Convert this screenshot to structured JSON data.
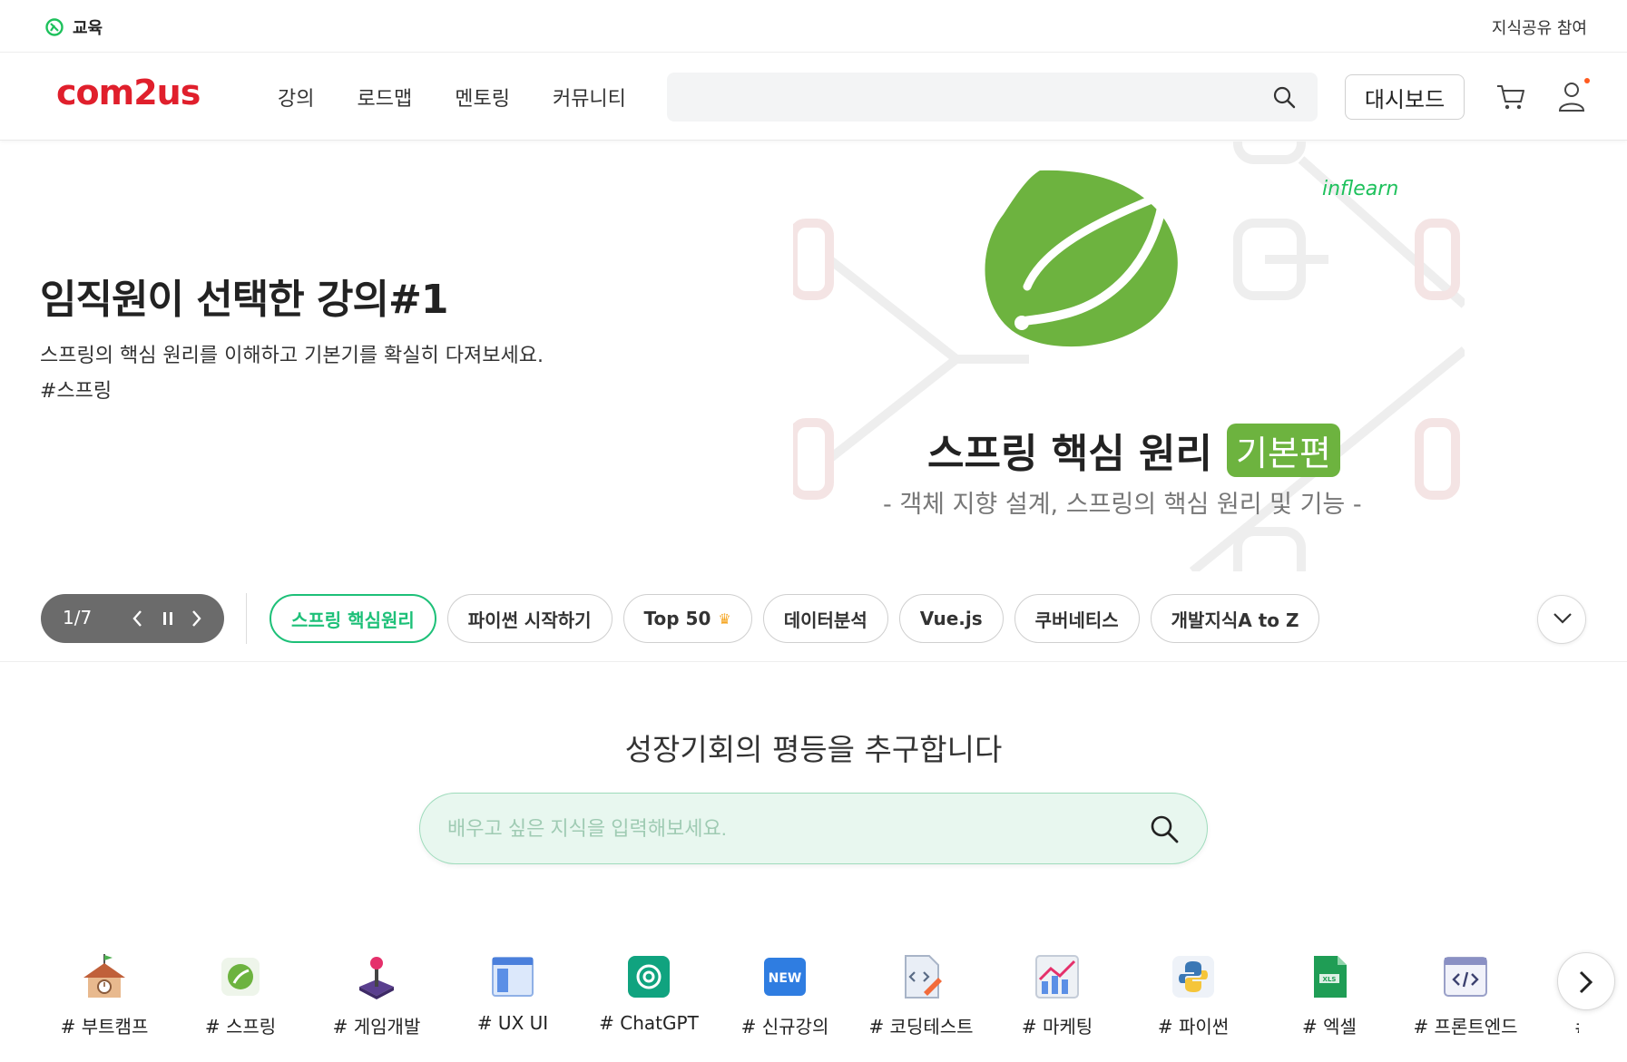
{
  "topbar": {
    "edu_label": "교육",
    "share_label": "지식공유 참여"
  },
  "header": {
    "logo": "com2us",
    "nav": [
      "강의",
      "로드맵",
      "멘토링",
      "커뮤니티"
    ],
    "search_placeholder": "",
    "dashboard_label": "대시보드"
  },
  "hero": {
    "title": "임직원이 선택한 강의#1",
    "subtitle": "스프링의 핵심 원리를 이해하고 기본기를 확실히 다져보세요.",
    "tag": "#스프링",
    "art": {
      "brand": "inflearn",
      "title": "스프링 핵심 원리",
      "badge": "기본편",
      "subtitle": "- 객체 지향 설계, 스프링의 핵심 원리 및 기능 -"
    }
  },
  "carousel": {
    "count": "1/7",
    "chips": [
      {
        "label": "스프링 핵심원리",
        "active": true
      },
      {
        "label": "파이썬 시작하기",
        "active": false
      },
      {
        "label": "Top 50",
        "active": false,
        "icon": "crown-icon"
      },
      {
        "label": "데이터분석",
        "active": false
      },
      {
        "label": "Vue.js",
        "active": false
      },
      {
        "label": "쿠버네티스",
        "active": false
      },
      {
        "label": "개발지식A to Z",
        "active": false
      }
    ]
  },
  "mission": "성장기회의 평등을 추구합니다",
  "main_search": {
    "placeholder": "배우고 싶은 지식을 입력해보세요."
  },
  "categories": [
    {
      "label": "# 부트캠프",
      "icon": "school-house-icon"
    },
    {
      "label": "# 스프링",
      "icon": "spring-leaf-icon"
    },
    {
      "label": "# 게임개발",
      "icon": "joystick-icon"
    },
    {
      "label": "# UX UI",
      "icon": "window-layout-icon"
    },
    {
      "label": "# ChatGPT",
      "icon": "chatgpt-icon"
    },
    {
      "label": "# 신규강의",
      "icon": "new-badge-icon"
    },
    {
      "label": "# 코딩테스트",
      "icon": "code-document-icon"
    },
    {
      "label": "# 마케팅",
      "icon": "growth-chart-icon"
    },
    {
      "label": "# 파이썬",
      "icon": "python-icon"
    },
    {
      "label": "# 엑셀",
      "icon": "excel-file-icon"
    },
    {
      "label": "# 프론트엔드",
      "icon": "code-window-icon"
    },
    {
      "label": "# 데브",
      "icon": "category-icon"
    }
  ],
  "colors": {
    "brand_red": "#e01f2c",
    "accent_green": "#1dc078",
    "spring_green": "#6db33f",
    "inflearn_green": "#1ec15c"
  }
}
